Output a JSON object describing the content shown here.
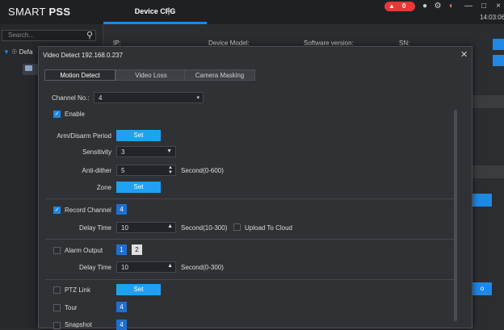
{
  "app": {
    "brand_regular": "SMART ",
    "brand_bold": "PSS",
    "active_tab": "Device CFG",
    "add_tab_symbol": "+",
    "alarm_count": "0",
    "time": "14:03:06"
  },
  "sidebar": {
    "search_placeholder": "Search...",
    "root_label": "Defa"
  },
  "device_info": {
    "ip_label": "IP:",
    "model_label": "Device Model:",
    "software_label": "Software version:",
    "sn_label": "SN:"
  },
  "dialog": {
    "title": "Video Detect 192.168.0.237",
    "tabs": [
      "Motion Detect",
      "Video Loss",
      "Camera Masking"
    ],
    "channel_label": "Channel No.:",
    "channel_value": "4",
    "enable_label": "Enable",
    "arm_label": "Arm/Disarm Period",
    "set_label": "Set",
    "sensitivity_label": "Sensitivity",
    "sensitivity_value": "3",
    "antidither_label": "Anti-dither",
    "antidither_value": "5",
    "antidither_unit": "Second(0-600)",
    "zone_label": "Zone",
    "record_channel_label": "Record Channel",
    "record_channel_value": "4",
    "delay_label": "Delay Time",
    "record_delay_value": "10",
    "record_delay_unit": "Second(10-300)",
    "upload_label": "Upload To Cloud",
    "alarm_output_label": "Alarm Output",
    "alarm_output_1": "1",
    "alarm_output_2": "2",
    "alarm_delay_value": "10",
    "alarm_delay_unit": "Second(0-300)",
    "ptz_label": "PTZ Link",
    "tour_label": "Tour",
    "tour_value": "4",
    "snapshot_label": "Snapshot",
    "snapshot_value": "4"
  },
  "background": {
    "partial_button": "o"
  },
  "colors": {
    "accent": "#1ea1f2",
    "alarm": "#e53935",
    "tab_underline": "#1e88e5"
  }
}
